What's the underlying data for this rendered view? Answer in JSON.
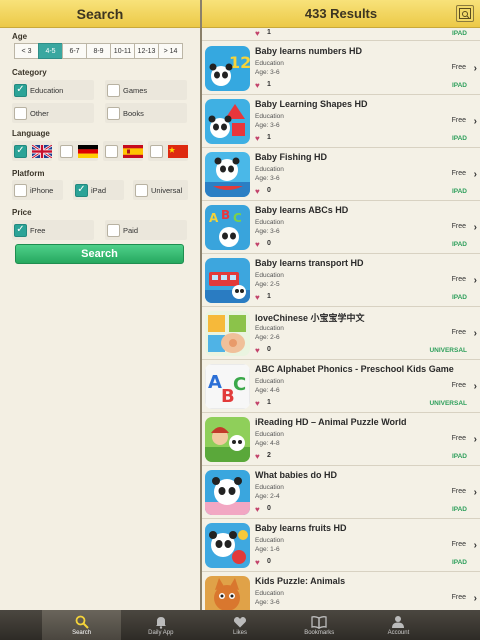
{
  "search_panel": {
    "title": "Search",
    "age": {
      "label": "Age",
      "options": [
        "< 3",
        "4-5",
        "6-7",
        "8-9",
        "10-11",
        "12-13",
        "> 14"
      ],
      "selected": "4-5"
    },
    "category": {
      "label": "Category",
      "options": [
        {
          "label": "Education",
          "checked": true
        },
        {
          "label": "Games",
          "checked": false
        },
        {
          "label": "Other",
          "checked": false
        },
        {
          "label": "Books",
          "checked": false
        }
      ]
    },
    "language": {
      "label": "Language",
      "options": [
        {
          "flag": "uk-flag-icon",
          "checked": true
        },
        {
          "flag": "germany-flag-icon",
          "checked": false
        },
        {
          "flag": "spain-flag-icon",
          "checked": false
        },
        {
          "flag": "china-flag-icon",
          "checked": false
        }
      ]
    },
    "platform": {
      "label": "Platform",
      "options": [
        {
          "label": "iPhone",
          "checked": false
        },
        {
          "label": "iPad",
          "checked": true
        },
        {
          "label": "Universal",
          "checked": false
        }
      ]
    },
    "price": {
      "label": "Price",
      "options": [
        {
          "label": "Free",
          "checked": true
        },
        {
          "label": "Paid",
          "checked": false
        }
      ]
    },
    "search_button": "Search"
  },
  "results": {
    "title": "433 Results",
    "partial_row": {
      "likes": "1",
      "platform": "IPAD"
    },
    "items": [
      {
        "title": "Baby learns numbers HD",
        "category": "Education",
        "age": "Age: 3-6",
        "likes": "1",
        "price": "Free",
        "platform": "IPAD",
        "icon": "panda-numbers-app-icon"
      },
      {
        "title": "Baby Learning Shapes HD",
        "category": "Education",
        "age": "Age: 3-6",
        "likes": "1",
        "price": "Free",
        "platform": "IPAD",
        "icon": "panda-shapes-app-icon"
      },
      {
        "title": "Baby Fishing HD",
        "category": "Education",
        "age": "Age: 3-6",
        "likes": "0",
        "price": "Free",
        "platform": "IPAD",
        "icon": "panda-fishing-app-icon"
      },
      {
        "title": "Baby learns ABCs HD",
        "category": "Education",
        "age": "Age: 3-6",
        "likes": "0",
        "price": "Free",
        "platform": "IPAD",
        "icon": "panda-abc-app-icon"
      },
      {
        "title": "Baby learns transport HD",
        "category": "Education",
        "age": "Age: 2-5",
        "likes": "1",
        "price": "Free",
        "platform": "IPAD",
        "icon": "panda-transport-app-icon"
      },
      {
        "title": "loveChinese 小宝宝学中文",
        "category": "Education",
        "age": "Age: 2-6",
        "likes": "0",
        "price": "Free",
        "platform": "UNIVERSAL",
        "icon": "love-chinese-app-icon"
      },
      {
        "title": "ABC Alphabet Phonics - Preschool Kids Game",
        "category": "Education",
        "age": "Age: 4-6",
        "likes": "1",
        "price": "Free",
        "platform": "UNIVERSAL",
        "icon": "abc-phonics-app-icon"
      },
      {
        "title": "iReading HD – Animal Puzzle World",
        "category": "Education",
        "age": "Age: 4-8",
        "likes": "2",
        "price": "Free",
        "platform": "IPAD",
        "icon": "ireading-app-icon"
      },
      {
        "title": "What babies do HD",
        "category": "Education",
        "age": "Age: 2-4",
        "likes": "0",
        "price": "Free",
        "platform": "IPAD",
        "icon": "panda-babies-app-icon"
      },
      {
        "title": "Baby learns fruits HD",
        "category": "Education",
        "age": "Age: 1-6",
        "likes": "0",
        "price": "Free",
        "platform": "IPAD",
        "icon": "panda-fruits-app-icon"
      },
      {
        "title": "Kids Puzzle: Animals",
        "category": "Education",
        "age": "Age: 3-6",
        "likes": "",
        "price": "Free",
        "platform": "",
        "icon": "kids-puzzle-app-icon"
      }
    ]
  },
  "tabbar": [
    {
      "label": "Search",
      "icon": "search-icon",
      "active": true
    },
    {
      "label": "Daily App",
      "icon": "bell-icon",
      "active": false
    },
    {
      "label": "Likes",
      "icon": "heart-icon",
      "active": false
    },
    {
      "label": "Bookmarks",
      "icon": "book-icon",
      "active": false
    },
    {
      "label": "Account",
      "icon": "person-icon",
      "active": false
    }
  ],
  "colors": {
    "accent_green": "#2ba397",
    "header_yellow": "#ecc947",
    "platform_green": "#2e9f5b",
    "heart_pink": "#c2436b"
  }
}
